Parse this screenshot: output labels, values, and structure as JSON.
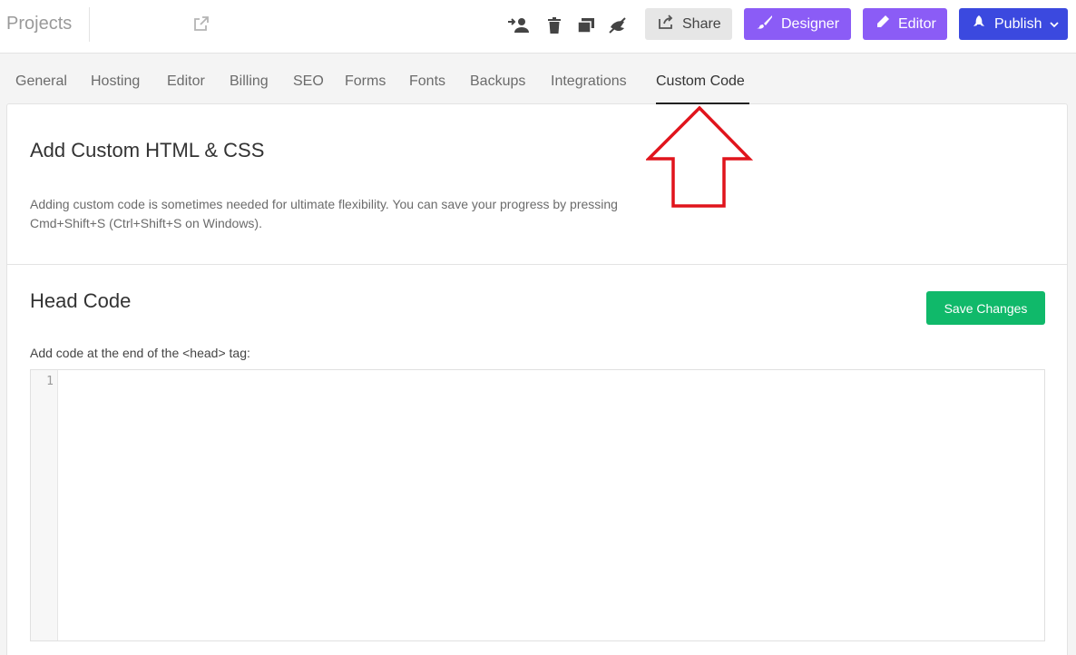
{
  "header": {
    "projects_label": "Projects",
    "share_label": "Share",
    "designer_label": "Designer",
    "editor_label": "Editor",
    "publish_label": "Publish"
  },
  "tabs": [
    {
      "label": "General"
    },
    {
      "label": "Hosting"
    },
    {
      "label": "Editor"
    },
    {
      "label": "Billing"
    },
    {
      "label": "SEO"
    },
    {
      "label": "Forms"
    },
    {
      "label": "Fonts"
    },
    {
      "label": "Backups"
    },
    {
      "label": "Integrations"
    },
    {
      "label": "Custom Code"
    }
  ],
  "active_tab": "Custom Code",
  "custom_code": {
    "title": "Add Custom HTML & CSS",
    "description": "Adding custom code is sometimes needed for ultimate flexibility. You can save your progress by pressing Cmd+Shift+S (Ctrl+Shift+S on Windows).",
    "head_title": "Head Code",
    "save_label": "Save Changes",
    "field_label": "Add code at the end of the <head> tag:",
    "line_number": "1"
  },
  "colors": {
    "designer": "#8b5cf6",
    "editor": "#8b5cf6",
    "publish": "#3b49df",
    "save": "#10b96a",
    "annotation_arrow": "#e0141c"
  },
  "icons": [
    "external-link-icon",
    "transfer-user-icon",
    "trash-icon",
    "duplicate-icon",
    "unpublish-icon",
    "share-icon",
    "brush-icon",
    "pencil-icon",
    "rocket-icon",
    "chevron-down-icon"
  ]
}
